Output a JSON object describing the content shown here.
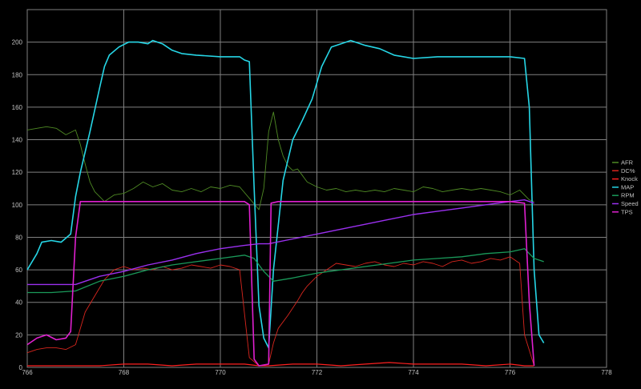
{
  "chart_data": {
    "type": "line",
    "title": "",
    "xlabel": "",
    "ylabel": "",
    "xlim": [
      766,
      778
    ],
    "ylim": [
      0,
      220
    ],
    "x_ticks": [
      766,
      768,
      770,
      772,
      774,
      776,
      778
    ],
    "y_ticks": [
      0,
      20,
      40,
      60,
      80,
      100,
      120,
      140,
      160,
      180,
      200
    ],
    "grid": "on",
    "legend_position": "right",
    "background_color": "#000000",
    "grid_color": "#808080",
    "series": [
      {
        "name": "AFR",
        "color": "#4f8a24",
        "stroke_width": 0.9,
        "points": [
          [
            766.0,
            146
          ],
          [
            766.2,
            147
          ],
          [
            766.4,
            148
          ],
          [
            766.6,
            147
          ],
          [
            766.8,
            143
          ],
          [
            767.0,
            146
          ],
          [
            767.1,
            137
          ],
          [
            767.2,
            125
          ],
          [
            767.3,
            114
          ],
          [
            767.4,
            108
          ],
          [
            767.5,
            105
          ],
          [
            767.6,
            102
          ],
          [
            767.8,
            106
          ],
          [
            768.0,
            107
          ],
          [
            768.2,
            110
          ],
          [
            768.4,
            114
          ],
          [
            768.6,
            111
          ],
          [
            768.8,
            113
          ],
          [
            769.0,
            109
          ],
          [
            769.2,
            108
          ],
          [
            769.4,
            110
          ],
          [
            769.6,
            108
          ],
          [
            769.8,
            111
          ],
          [
            770.0,
            110
          ],
          [
            770.2,
            112
          ],
          [
            770.4,
            111
          ],
          [
            770.6,
            104
          ],
          [
            770.8,
            97
          ],
          [
            770.9,
            110
          ],
          [
            771.0,
            145
          ],
          [
            771.1,
            157
          ],
          [
            771.2,
            140
          ],
          [
            771.3,
            130
          ],
          [
            771.4,
            124
          ],
          [
            771.5,
            121
          ],
          [
            771.6,
            122
          ],
          [
            771.7,
            118
          ],
          [
            771.8,
            114
          ],
          [
            772.0,
            111
          ],
          [
            772.2,
            109
          ],
          [
            772.4,
            110
          ],
          [
            772.6,
            108
          ],
          [
            772.8,
            109
          ],
          [
            773.0,
            108
          ],
          [
            773.2,
            109
          ],
          [
            773.4,
            108
          ],
          [
            773.6,
            110
          ],
          [
            773.8,
            109
          ],
          [
            774.0,
            108
          ],
          [
            774.2,
            111
          ],
          [
            774.4,
            110
          ],
          [
            774.6,
            108
          ],
          [
            774.8,
            109
          ],
          [
            775.0,
            110
          ],
          [
            775.2,
            109
          ],
          [
            775.4,
            110
          ],
          [
            775.6,
            109
          ],
          [
            775.8,
            108
          ],
          [
            776.0,
            106
          ],
          [
            776.2,
            109
          ],
          [
            776.4,
            103
          ],
          [
            776.5,
            102
          ]
        ]
      },
      {
        "name": "DC%",
        "color": "#d8261e",
        "stroke_width": 0.9,
        "points": [
          [
            766.0,
            9
          ],
          [
            766.2,
            11
          ],
          [
            766.4,
            12
          ],
          [
            766.6,
            12
          ],
          [
            766.8,
            11
          ],
          [
            767.0,
            14
          ],
          [
            767.1,
            24
          ],
          [
            767.2,
            34
          ],
          [
            767.4,
            44
          ],
          [
            767.6,
            54
          ],
          [
            767.8,
            60
          ],
          [
            768.0,
            62
          ],
          [
            768.2,
            60
          ],
          [
            768.4,
            61
          ],
          [
            768.6,
            60
          ],
          [
            768.8,
            62
          ],
          [
            769.0,
            60
          ],
          [
            769.2,
            61
          ],
          [
            769.4,
            63
          ],
          [
            769.6,
            62
          ],
          [
            769.8,
            61
          ],
          [
            770.0,
            63
          ],
          [
            770.2,
            62
          ],
          [
            770.4,
            60
          ],
          [
            770.6,
            6
          ],
          [
            770.8,
            1
          ],
          [
            771.0,
            2
          ],
          [
            771.1,
            15
          ],
          [
            771.2,
            24
          ],
          [
            771.4,
            32
          ],
          [
            771.6,
            41
          ],
          [
            771.7,
            46
          ],
          [
            771.8,
            50
          ],
          [
            772.0,
            56
          ],
          [
            772.2,
            60
          ],
          [
            772.4,
            64
          ],
          [
            772.6,
            63
          ],
          [
            772.8,
            62
          ],
          [
            773.0,
            64
          ],
          [
            773.2,
            65
          ],
          [
            773.4,
            63
          ],
          [
            773.6,
            62
          ],
          [
            773.8,
            64
          ],
          [
            774.0,
            63
          ],
          [
            774.2,
            65
          ],
          [
            774.4,
            64
          ],
          [
            774.6,
            62
          ],
          [
            774.8,
            65
          ],
          [
            775.0,
            66
          ],
          [
            775.2,
            64
          ],
          [
            775.4,
            65
          ],
          [
            775.6,
            67
          ],
          [
            775.8,
            66
          ],
          [
            776.0,
            68
          ],
          [
            776.2,
            64
          ],
          [
            776.3,
            20
          ],
          [
            776.5,
            1
          ]
        ]
      },
      {
        "name": "Knock",
        "color": "#ff2020",
        "stroke_width": 1.2,
        "points": [
          [
            766.0,
            1
          ],
          [
            766.5,
            1
          ],
          [
            767.0,
            1
          ],
          [
            767.5,
            1
          ],
          [
            768.0,
            2
          ],
          [
            768.5,
            2
          ],
          [
            769.0,
            1
          ],
          [
            769.5,
            2
          ],
          [
            770.0,
            2
          ],
          [
            770.5,
            2
          ],
          [
            770.8,
            1
          ],
          [
            771.0,
            1
          ],
          [
            771.5,
            2
          ],
          [
            772.0,
            2
          ],
          [
            772.5,
            1
          ],
          [
            773.0,
            2
          ],
          [
            773.5,
            3
          ],
          [
            774.0,
            2
          ],
          [
            774.5,
            2
          ],
          [
            775.0,
            2
          ],
          [
            775.5,
            1
          ],
          [
            776.0,
            2
          ],
          [
            776.3,
            1
          ],
          [
            776.5,
            1
          ]
        ]
      },
      {
        "name": "MAP",
        "color": "#26d6e6",
        "stroke_width": 1.6,
        "points": [
          [
            766.0,
            60
          ],
          [
            766.2,
            70
          ],
          [
            766.3,
            77
          ],
          [
            766.5,
            78
          ],
          [
            766.7,
            77
          ],
          [
            766.9,
            82
          ],
          [
            767.0,
            105
          ],
          [
            767.1,
            120
          ],
          [
            767.3,
            145
          ],
          [
            767.5,
            172
          ],
          [
            767.6,
            185
          ],
          [
            767.7,
            192
          ],
          [
            767.9,
            197
          ],
          [
            768.1,
            200
          ],
          [
            768.3,
            200
          ],
          [
            768.5,
            199
          ],
          [
            768.6,
            201
          ],
          [
            768.8,
            199
          ],
          [
            769.0,
            195
          ],
          [
            769.2,
            193
          ],
          [
            769.5,
            192
          ],
          [
            770.0,
            191
          ],
          [
            770.4,
            191
          ],
          [
            770.5,
            189
          ],
          [
            770.6,
            188
          ],
          [
            770.7,
            110
          ],
          [
            770.8,
            38
          ],
          [
            770.9,
            18
          ],
          [
            771.0,
            12
          ],
          [
            771.1,
            60
          ],
          [
            771.3,
            115
          ],
          [
            771.5,
            140
          ],
          [
            771.7,
            152
          ],
          [
            771.9,
            165
          ],
          [
            772.1,
            185
          ],
          [
            772.3,
            197
          ],
          [
            772.5,
            199
          ],
          [
            772.7,
            201
          ],
          [
            773.0,
            198
          ],
          [
            773.3,
            196
          ],
          [
            773.6,
            192
          ],
          [
            774.0,
            190
          ],
          [
            774.5,
            191
          ],
          [
            775.0,
            191
          ],
          [
            775.5,
            191
          ],
          [
            776.0,
            191
          ],
          [
            776.3,
            190
          ],
          [
            776.4,
            160
          ],
          [
            776.5,
            60
          ],
          [
            776.6,
            20
          ],
          [
            776.7,
            15
          ]
        ]
      },
      {
        "name": "RPM",
        "color": "#1a9a5a",
        "stroke_width": 1.3,
        "points": [
          [
            766.0,
            46
          ],
          [
            766.5,
            46
          ],
          [
            767.0,
            47
          ],
          [
            767.5,
            53
          ],
          [
            768.0,
            56
          ],
          [
            768.5,
            60
          ],
          [
            769.0,
            63
          ],
          [
            769.5,
            65
          ],
          [
            770.0,
            67
          ],
          [
            770.5,
            69
          ],
          [
            770.7,
            67
          ],
          [
            770.9,
            59
          ],
          [
            771.1,
            53
          ],
          [
            771.5,
            55
          ],
          [
            772.0,
            58
          ],
          [
            772.5,
            60
          ],
          [
            773.0,
            62
          ],
          [
            773.5,
            64
          ],
          [
            774.0,
            66
          ],
          [
            774.5,
            67
          ],
          [
            775.0,
            68
          ],
          [
            775.5,
            70
          ],
          [
            776.0,
            71
          ],
          [
            776.3,
            73
          ],
          [
            776.5,
            67
          ],
          [
            776.7,
            65
          ]
        ]
      },
      {
        "name": "Speed",
        "color": "#9b30f0",
        "stroke_width": 1.4,
        "points": [
          [
            766.0,
            51
          ],
          [
            766.5,
            51
          ],
          [
            767.0,
            51
          ],
          [
            767.5,
            56
          ],
          [
            768.0,
            59
          ],
          [
            768.5,
            63
          ],
          [
            769.0,
            66
          ],
          [
            769.5,
            70
          ],
          [
            770.0,
            73
          ],
          [
            770.5,
            75
          ],
          [
            770.8,
            76
          ],
          [
            771.0,
            76
          ],
          [
            771.5,
            79
          ],
          [
            772.0,
            82
          ],
          [
            772.5,
            85
          ],
          [
            773.0,
            88
          ],
          [
            773.5,
            91
          ],
          [
            774.0,
            94
          ],
          [
            774.5,
            96
          ],
          [
            775.0,
            98
          ],
          [
            775.5,
            100
          ],
          [
            776.0,
            102
          ],
          [
            776.3,
            103
          ],
          [
            776.5,
            101
          ]
        ]
      },
      {
        "name": "TPS",
        "color": "#e020d0",
        "stroke_width": 1.6,
        "points": [
          [
            766.0,
            14
          ],
          [
            766.2,
            18
          ],
          [
            766.4,
            20
          ],
          [
            766.6,
            17
          ],
          [
            766.8,
            18
          ],
          [
            766.9,
            22
          ],
          [
            767.0,
            80
          ],
          [
            767.1,
            102
          ],
          [
            767.5,
            102
          ],
          [
            768.0,
            102
          ],
          [
            769.0,
            102
          ],
          [
            770.0,
            102
          ],
          [
            770.5,
            102
          ],
          [
            770.6,
            100
          ],
          [
            770.7,
            5
          ],
          [
            770.8,
            1
          ],
          [
            771.0,
            2
          ],
          [
            771.05,
            101
          ],
          [
            771.2,
            102
          ],
          [
            772.0,
            102
          ],
          [
            773.0,
            102
          ],
          [
            774.0,
            102
          ],
          [
            775.0,
            102
          ],
          [
            776.0,
            102
          ],
          [
            776.3,
            101
          ],
          [
            776.4,
            40
          ],
          [
            776.5,
            1
          ]
        ]
      }
    ]
  }
}
